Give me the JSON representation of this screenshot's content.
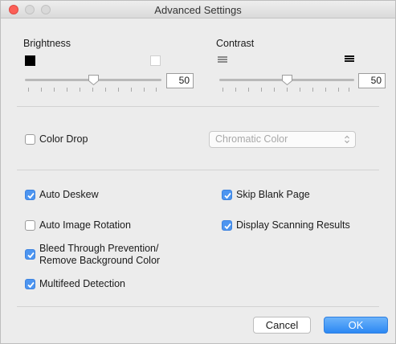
{
  "window": {
    "title": "Advanced Settings"
  },
  "brightness": {
    "label": "Brightness",
    "min_icon": "black-square-icon",
    "max_icon": "white-square-icon",
    "value": "50",
    "slider_fraction": 0.5
  },
  "contrast": {
    "label": "Contrast",
    "min_icon": "low-contrast-icon",
    "max_icon": "high-contrast-icon",
    "value": "50",
    "slider_fraction": 0.5
  },
  "color_drop": {
    "label": "Color Drop",
    "checked": false,
    "select_value": "Chromatic Color",
    "enabled": false
  },
  "options": {
    "auto_deskew": {
      "label": "Auto Deskew",
      "checked": true
    },
    "skip_blank_page": {
      "label": "Skip Blank Page",
      "checked": true
    },
    "auto_image_rotation": {
      "label": "Auto Image Rotation",
      "checked": false
    },
    "display_scanning_results": {
      "label": "Display Scanning Results",
      "checked": true
    },
    "bleed_through": {
      "label_line1": "Bleed Through Prevention/",
      "label_line2": "Remove Background Color",
      "checked": true
    },
    "multifeed_detection": {
      "label": "Multifeed Detection",
      "checked": true
    }
  },
  "buttons": {
    "cancel": "Cancel",
    "ok": "OK"
  },
  "colors": {
    "accent": "#4d95f0",
    "close_button": "#fc5f57",
    "ok_button": "#2c88f3",
    "window_bg": "#ececec"
  }
}
